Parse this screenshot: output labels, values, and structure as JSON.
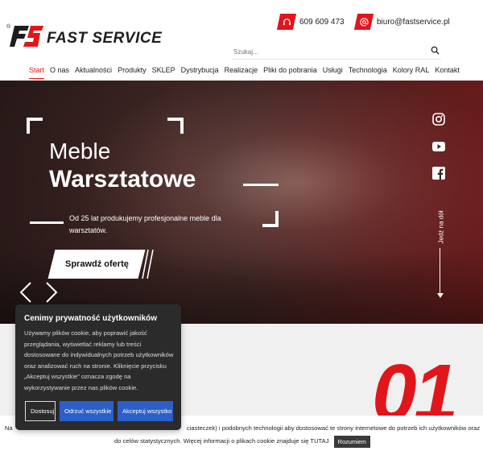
{
  "brand": {
    "registered": "®",
    "name": "FAST SERVICE"
  },
  "contacts": {
    "phone": {
      "text": "609 609 473",
      "icon": "headset-icon"
    },
    "email": {
      "text": "biuro@fastservice.pl",
      "icon": "at-sign-icon"
    }
  },
  "search": {
    "placeholder": "Szukaj...",
    "icon": "search-icon"
  },
  "nav": {
    "items": [
      {
        "label": "Start",
        "active": true
      },
      {
        "label": "O nas"
      },
      {
        "label": "Aktualności"
      },
      {
        "label": "Produkty"
      },
      {
        "label": "SKLEP"
      },
      {
        "label": "Dystrybucja"
      },
      {
        "label": "Realizacje"
      },
      {
        "label": "Pliki do pobrania"
      },
      {
        "label": "Usługi"
      },
      {
        "label": "Technologia"
      },
      {
        "label": "Kolory RAL"
      },
      {
        "label": "Kontakt"
      }
    ]
  },
  "hero": {
    "title_line1": "Meble",
    "title_line2": "Warsztatowe",
    "description": "Od 25 lat produkujemy profesjonalne meble dla warsztatów.",
    "cta": "Sprawdź ofertę",
    "scroll_label": "Jedź na dół",
    "social": [
      "instagram-icon",
      "youtube-icon",
      "facebook-icon"
    ]
  },
  "section": {
    "number": "01"
  },
  "cookie_modal": {
    "title": "Cenimy prywatność użytkowników",
    "text": "Używamy plików cookie, aby poprawić jakość przeglądania, wyświetlać reklamy lub treści dostosowane do indywidualnych potrzeb użytkowników oraz analizować ruch na stronie. Kliknięcie przycisku „Akceptuj wszystkie” oznacza zgodę na wykorzystywanie przez nas plików cookie.",
    "btn_decline": "Dostosuj",
    "btn_optional": "Odrzuć wszystkie",
    "btn_accept": "Akceptuj wszystko"
  },
  "cookie_bar": {
    "text_part1": "Na",
    "text_part2": "ciasteczek) i podobnych technologii aby dostosować te strony internetowe do potrzeb ich użytkowników oraz do celów statystycznych. Więcej informacji o plikach cookie znajduje się TUTAJ",
    "button": "Rozumiem"
  },
  "colors": {
    "accent": "#e0161b",
    "button_blue": "#2c60c8",
    "modal_bg": "#2b2b2b"
  }
}
